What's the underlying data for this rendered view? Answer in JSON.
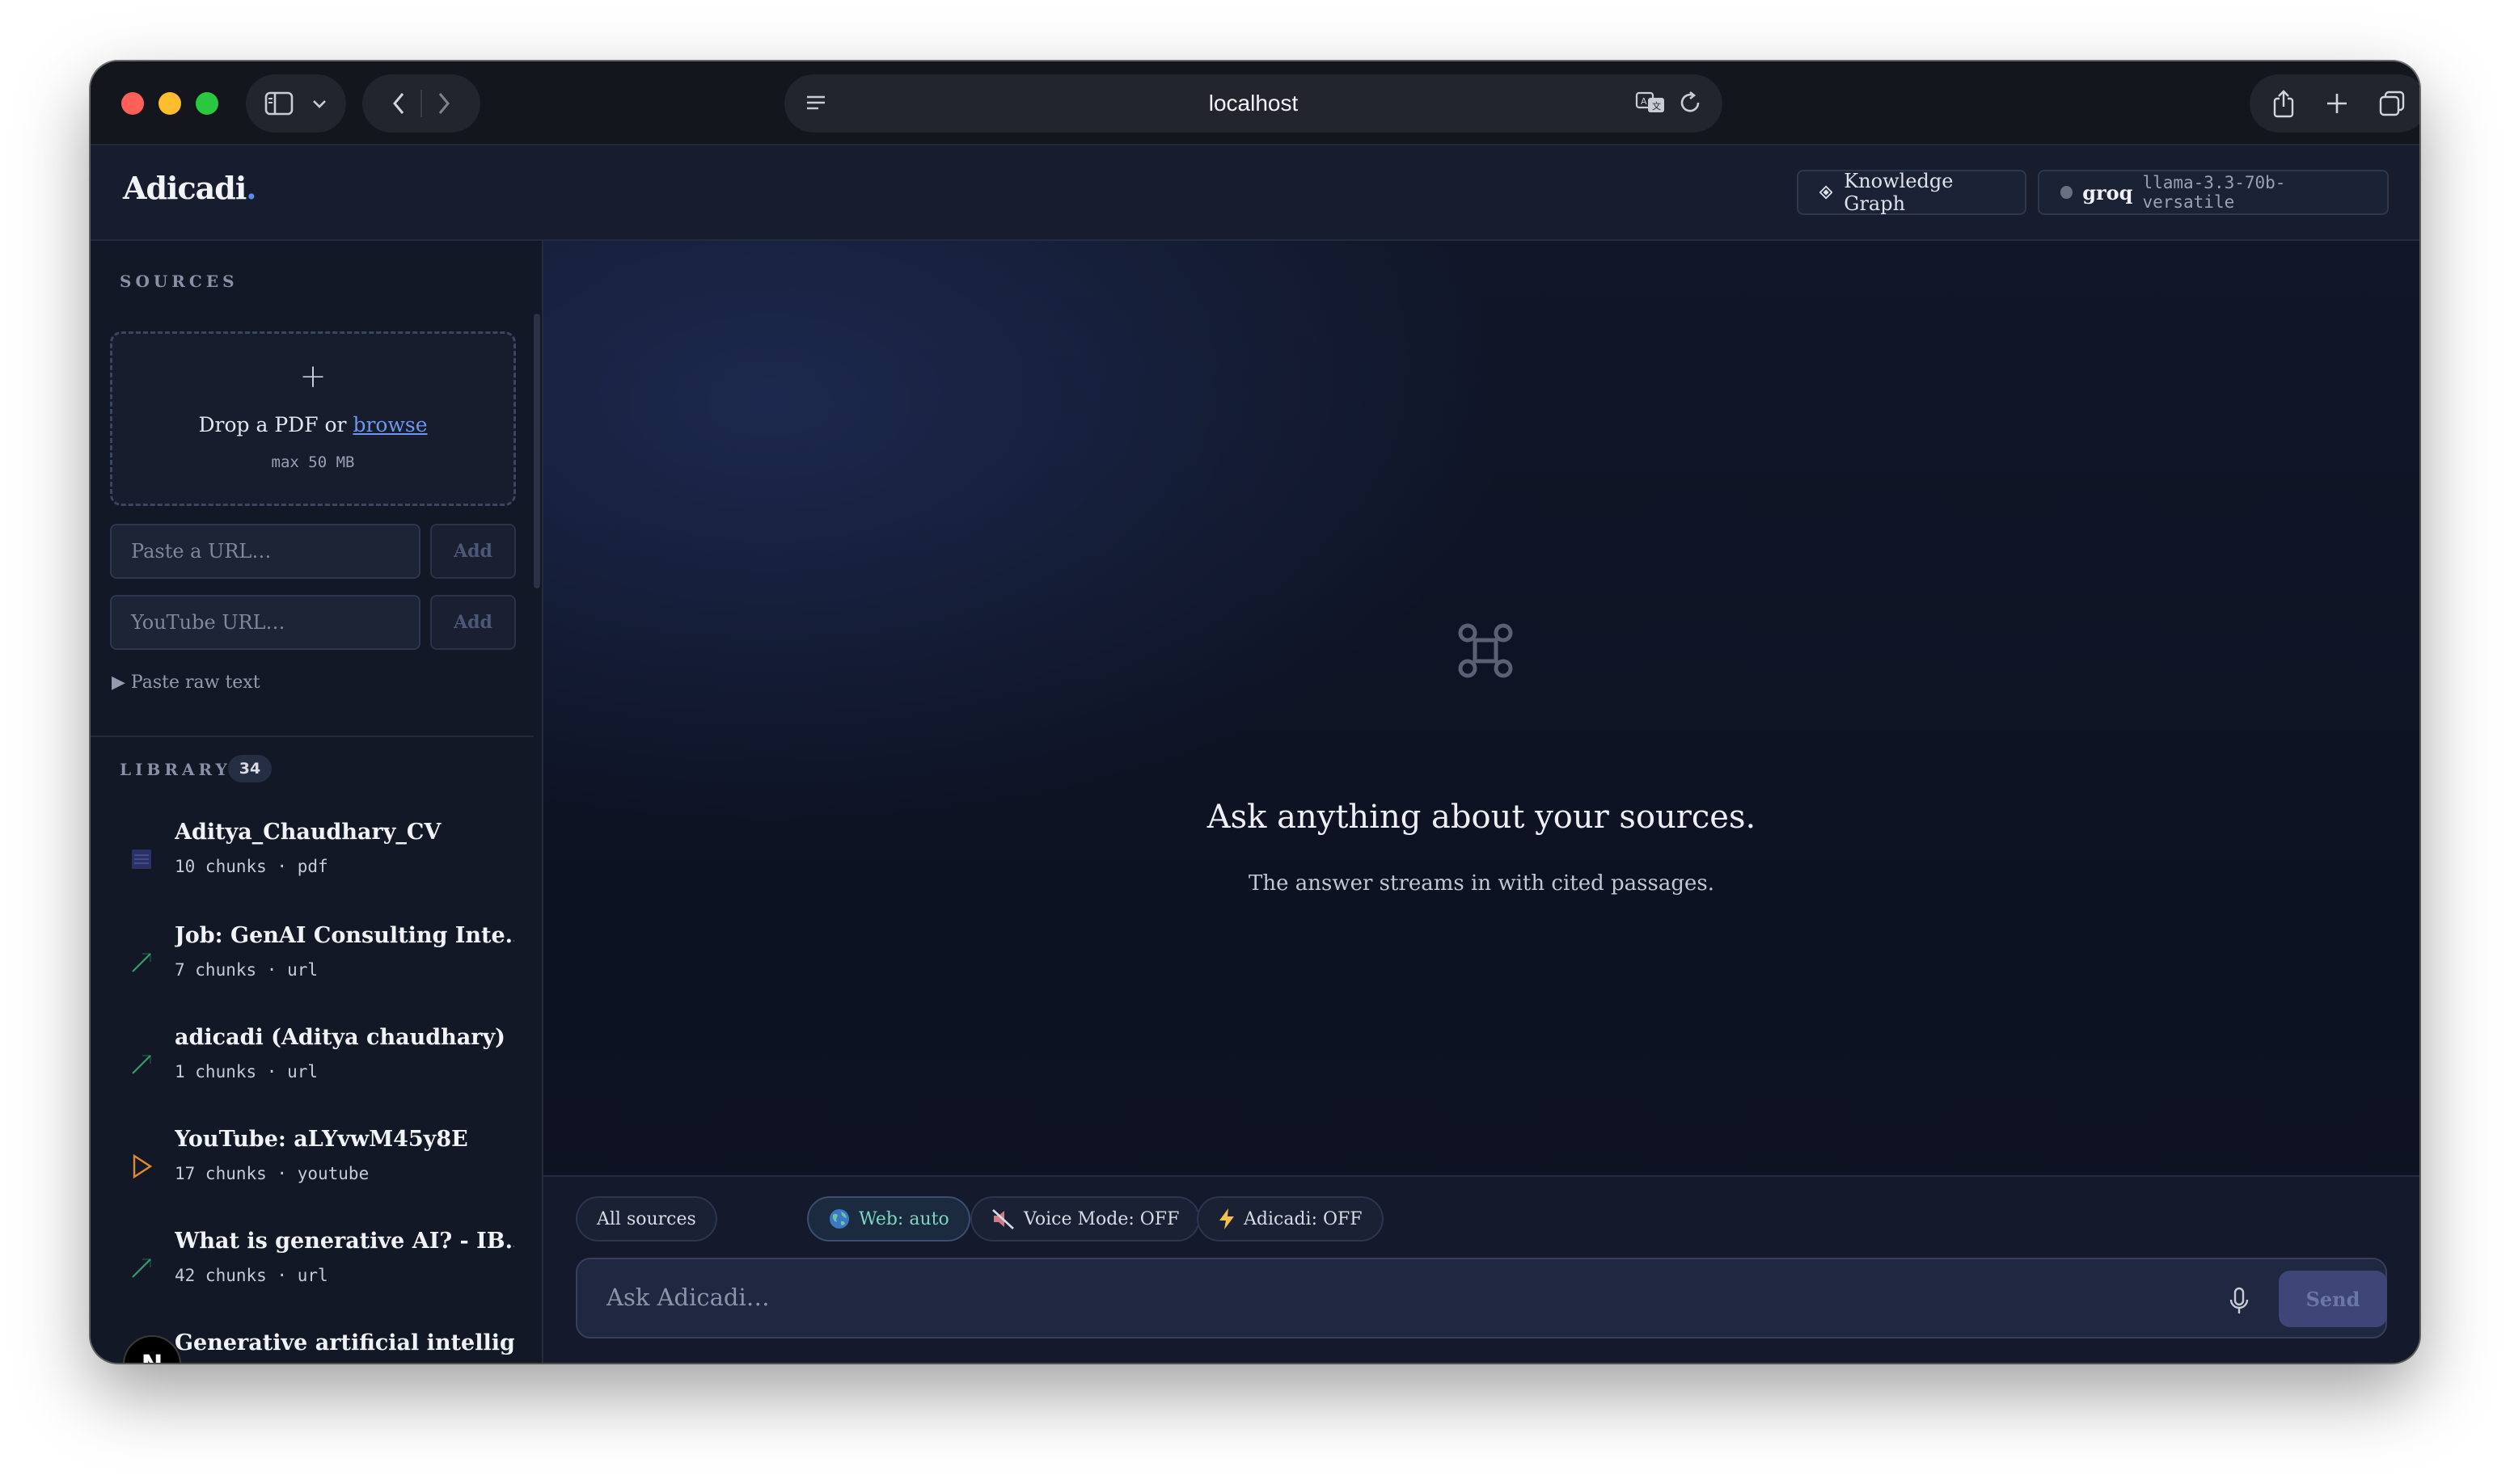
{
  "browser": {
    "url": "localhost"
  },
  "header": {
    "logo_text": "Adicadi",
    "logo_dot": ".",
    "knowledge_graph_label": "Knowledge Graph",
    "model_provider": "groq",
    "model_name": "llama-3.3-70b-versatile"
  },
  "sidebar": {
    "sources_label": "SOURCES",
    "dropzone": {
      "plus": "+",
      "text_prefix": "Drop a PDF or ",
      "browse_link": "browse",
      "limit": "max 50 MB"
    },
    "url_input": {
      "placeholder": "Paste a URL…",
      "add_label": "Add"
    },
    "youtube_input": {
      "placeholder": "YouTube URL…",
      "add_label": "Add"
    },
    "raw_text_toggle": "▶ Paste raw text",
    "library_label": "LIBRARY",
    "library_count": "34",
    "library": [
      {
        "title": "Aditya_Chaudhary_CV",
        "meta": "10 chunks · pdf",
        "icon": "pdf-icon"
      },
      {
        "title": "Job: GenAI Consulting Inte…",
        "meta": "7 chunks · url",
        "icon": "link-icon"
      },
      {
        "title": "adicadi (Aditya chaudhary) …",
        "meta": "1 chunks · url",
        "icon": "link-icon"
      },
      {
        "title": "YouTube: aLYvwM45y8E",
        "meta": "17 chunks · youtube",
        "icon": "play-icon"
      },
      {
        "title": "What is generative AI? - IB…",
        "meta": "42 chunks · url",
        "icon": "link-icon"
      },
      {
        "title": "Generative artificial intellig…",
        "meta": "",
        "icon": "link-icon"
      }
    ],
    "n_badge": "N"
  },
  "main": {
    "empty_title": "Ask anything about your sources.",
    "empty_subtitle": "The answer streams in with cited passages.",
    "chips": {
      "all_sources": "All sources",
      "web": "Web: auto",
      "voice": "Voice Mode: OFF",
      "adicadi": "Adicadi: OFF"
    },
    "ask_placeholder": "Ask Adicadi…",
    "send_label": "Send"
  },
  "colors": {
    "accent": "#5b8cf5",
    "background": "#0f1320",
    "web_chip": "#7fd4bf",
    "play_icon": "#e0892e",
    "link_icon": "#2f9e6e"
  }
}
